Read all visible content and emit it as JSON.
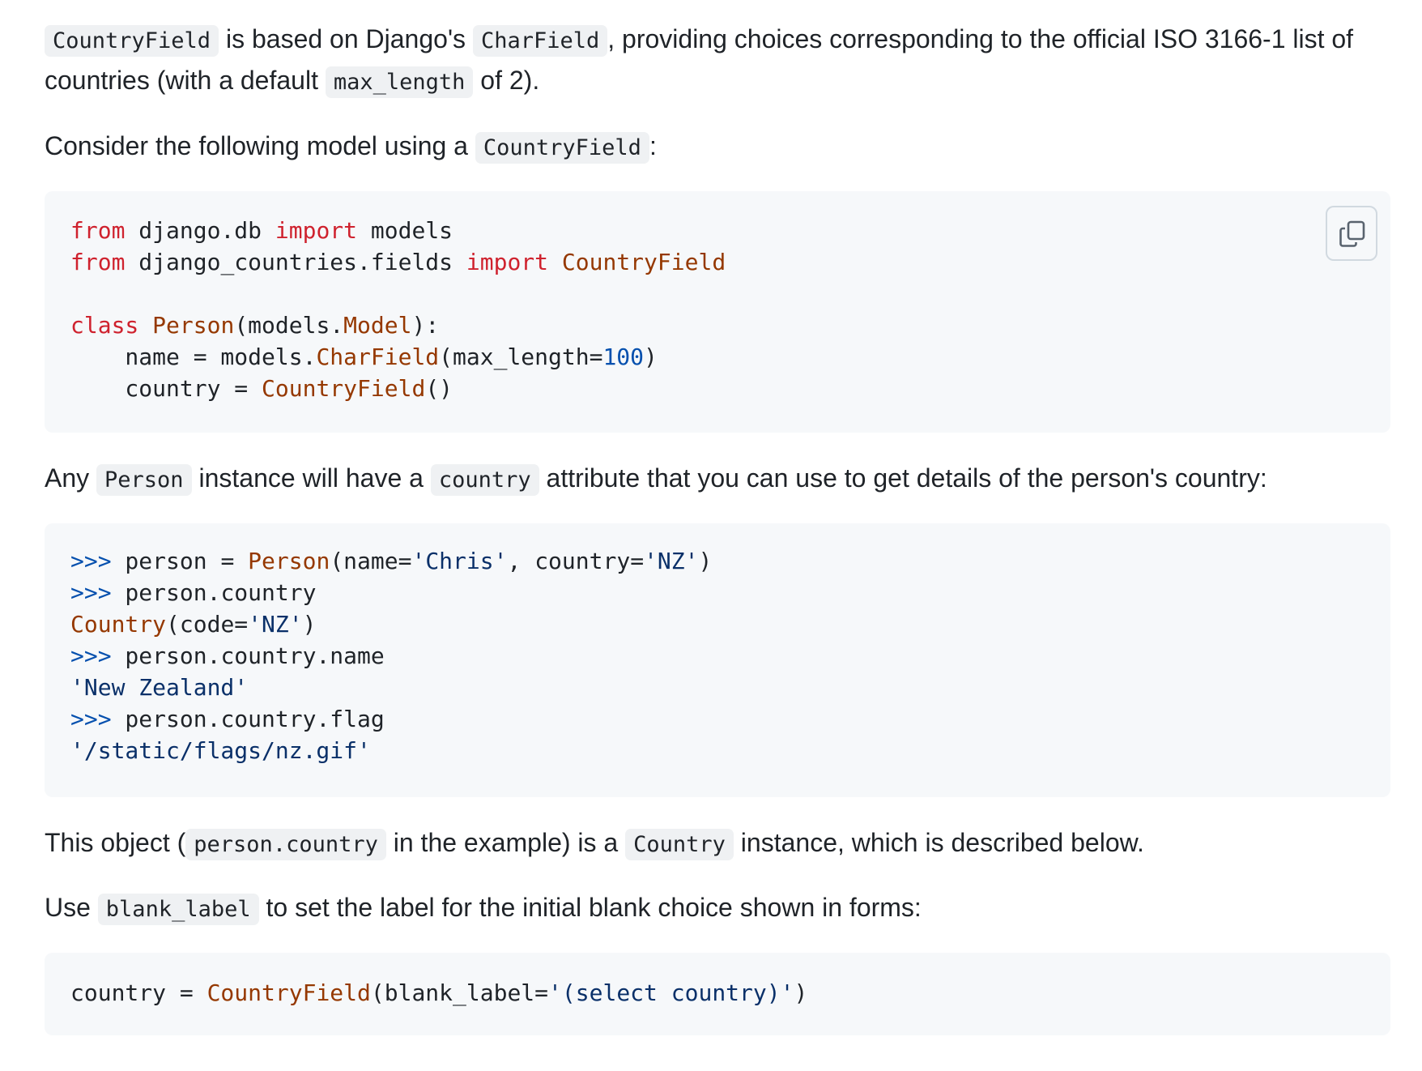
{
  "p1": {
    "code1": "CountryField",
    "t1": " is based on Django's ",
    "code2": "CharField",
    "t2": ", providing choices corresponding to the official ISO 3166-1 list of countries (with a default ",
    "code3": "max_length",
    "t3": " of 2)."
  },
  "p2": {
    "t1": "Consider the following model using a ",
    "code1": "CountryField",
    "t2": ":"
  },
  "block1": {
    "copy_icon": "copy-icon",
    "line1": {
      "from": "from",
      "mod": " django.db ",
      "import": "import",
      "name": " models"
    },
    "line2": {
      "from": "from",
      "mod": " django_countries.fields ",
      "import": "import",
      "name": " CountryField"
    },
    "line3": {
      "kw": "class",
      "name": "Person",
      "open": "(models.",
      "base": "Model",
      "close": "):"
    },
    "line4": {
      "indent": "    name = models.",
      "call": "CharField",
      "args": "(max_length=",
      "num": "100",
      "end": ")"
    },
    "line5": {
      "indent": "    country = ",
      "call": "CountryField",
      "end": "()"
    }
  },
  "p3": {
    "t1": "Any ",
    "code1": "Person",
    "t2": " instance will have a ",
    "code2": "country",
    "t3": " attribute that you can use to get details of the person's country:"
  },
  "block2": {
    "prompt": ">>>",
    "line1": {
      "text": " person = ",
      "call": "Person",
      "a": "(name=",
      "s1": "'Chris'",
      "b": ", country=",
      "s2": "'NZ'",
      "c": ")"
    },
    "line2": {
      "text": " person.country"
    },
    "line3": {
      "call": "Country",
      "a": "(code=",
      "s": "'NZ'",
      "c": ")"
    },
    "line4": {
      "text": " person.country.name"
    },
    "line5": {
      "s": "'New Zealand'"
    },
    "line6": {
      "text": " person.country.flag"
    },
    "line7": {
      "s": "'/static/flags/nz.gif'"
    }
  },
  "p4": {
    "t1": "This object (",
    "code1": "person.country",
    "t2": " in the example) is a ",
    "code2": "Country",
    "t3": " instance, which is described below."
  },
  "p5": {
    "t1": "Use ",
    "code1": "blank_label",
    "t2": " to set the label for the initial blank choice shown in forms:"
  },
  "block3": {
    "line1": {
      "text": "country = ",
      "call": "CountryField",
      "a": "(blank_label=",
      "s": "'(select country)'",
      "c": ")"
    }
  }
}
